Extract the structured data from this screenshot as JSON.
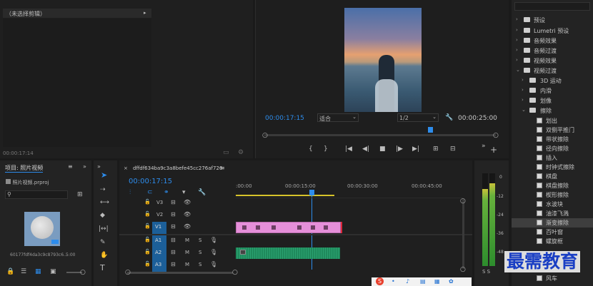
{
  "source_monitor": {
    "title": "（未选择剪辑）",
    "timecode": "00:00:17:14"
  },
  "program_monitor": {
    "timecode_left": "00:00:17:15",
    "fit_select": "适合",
    "quality_select": "1/2",
    "timecode_right": "00:00:25:00"
  },
  "project": {
    "tab_label": "项目: 照片视频",
    "file_name": "照片视频.prproj",
    "clip_name": "60177fdf4da3c9c8793c6...",
    "clip_duration": "5:00"
  },
  "timeline": {
    "tab_label": "dffdf634ba9c3a8befe45cc276af726",
    "timecode": "00:00:17:15",
    "ruler": [
      ":00:00",
      "00:00:15:00",
      "00:00:30:00",
      "00:00:45:00"
    ],
    "tracks": [
      {
        "label": "V3",
        "type": "video"
      },
      {
        "label": "V2",
        "type": "video"
      },
      {
        "label": "V1",
        "type": "video"
      },
      {
        "label": "A1",
        "type": "audio"
      },
      {
        "label": "A2",
        "type": "audio"
      },
      {
        "label": "A3",
        "type": "audio"
      }
    ],
    "m": "M",
    "s": "S"
  },
  "meter": {
    "scale": [
      "0",
      "-12",
      "-24",
      "-36",
      "-48"
    ],
    "solo": "S S"
  },
  "effects": {
    "items": [
      {
        "label": "预设",
        "kind": "folder"
      },
      {
        "label": "Lumetri 预设",
        "kind": "folder"
      },
      {
        "label": "音频效果",
        "kind": "folder"
      },
      {
        "label": "音频过渡",
        "kind": "folder"
      },
      {
        "label": "视频效果",
        "kind": "folder"
      },
      {
        "label": "视频过渡",
        "kind": "folder-open"
      },
      {
        "label": "3D 运动",
        "kind": "subfolder"
      },
      {
        "label": "内滑",
        "kind": "subfolder"
      },
      {
        "label": "划像",
        "kind": "subfolder"
      },
      {
        "label": "擦除",
        "kind": "subfolder-open"
      },
      {
        "label": "划出",
        "kind": "effect"
      },
      {
        "label": "双侧平推门",
        "kind": "effect"
      },
      {
        "label": "带状擦除",
        "kind": "effect"
      },
      {
        "label": "径向擦除",
        "kind": "effect"
      },
      {
        "label": "插入",
        "kind": "effect"
      },
      {
        "label": "时钟式擦除",
        "kind": "effect"
      },
      {
        "label": "棋盘",
        "kind": "effect"
      },
      {
        "label": "棋盘擦除",
        "kind": "effect"
      },
      {
        "label": "楔形擦除",
        "kind": "effect"
      },
      {
        "label": "水波块",
        "kind": "effect"
      },
      {
        "label": "油漆飞溅",
        "kind": "effect"
      },
      {
        "label": "渐变擦除",
        "kind": "effect-selected"
      },
      {
        "label": "百叶窗",
        "kind": "effect"
      },
      {
        "label": "螺旋框",
        "kind": "effect"
      },
      {
        "label": "风车",
        "kind": "effect"
      }
    ]
  },
  "watermark": "最需教育",
  "colors": {
    "accent": "#2d8ceb",
    "video_clip": "#e58fd9",
    "audio_clip": "#1f8a5c",
    "panel": "#232323"
  }
}
